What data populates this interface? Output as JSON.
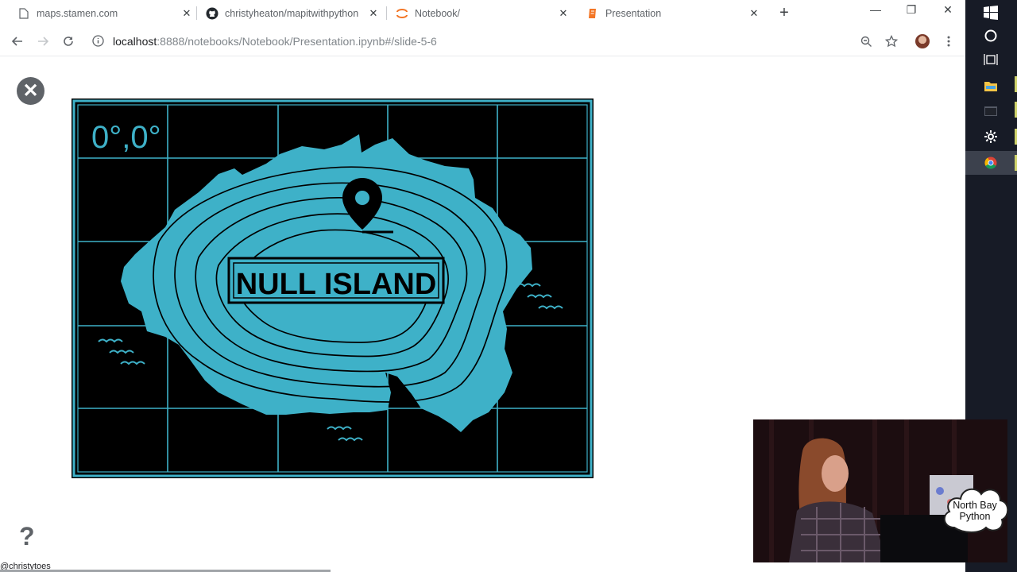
{
  "tabs": [
    {
      "title": "maps.stamen.com",
      "icon": "page-icon"
    },
    {
      "title": "christyheaton/mapitwithpython",
      "icon": "github-icon"
    },
    {
      "title": "Notebook/",
      "icon": "jupyter-icon"
    },
    {
      "title": "Presentation",
      "icon": "jupyter-orange-icon",
      "active": true
    }
  ],
  "tab_close": "✕",
  "new_tab": "+",
  "window": {
    "minimize": "—",
    "restore": "❐",
    "close": "✕"
  },
  "address": {
    "host": "localhost",
    "rest": ":8888/notebooks/Notebook/Presentation.ipynb#/slide-5-6"
  },
  "slide": {
    "coords": "0°,0°",
    "island_label": "NULL ISLAND",
    "help": "?",
    "close_symbol": "✕",
    "handle": "@christytoes"
  },
  "webcam": {
    "badge": "North Bay Python"
  },
  "colors": {
    "teal": "#3eb1c8",
    "art_bg": "#000000",
    "taskbar": "#171b26"
  }
}
